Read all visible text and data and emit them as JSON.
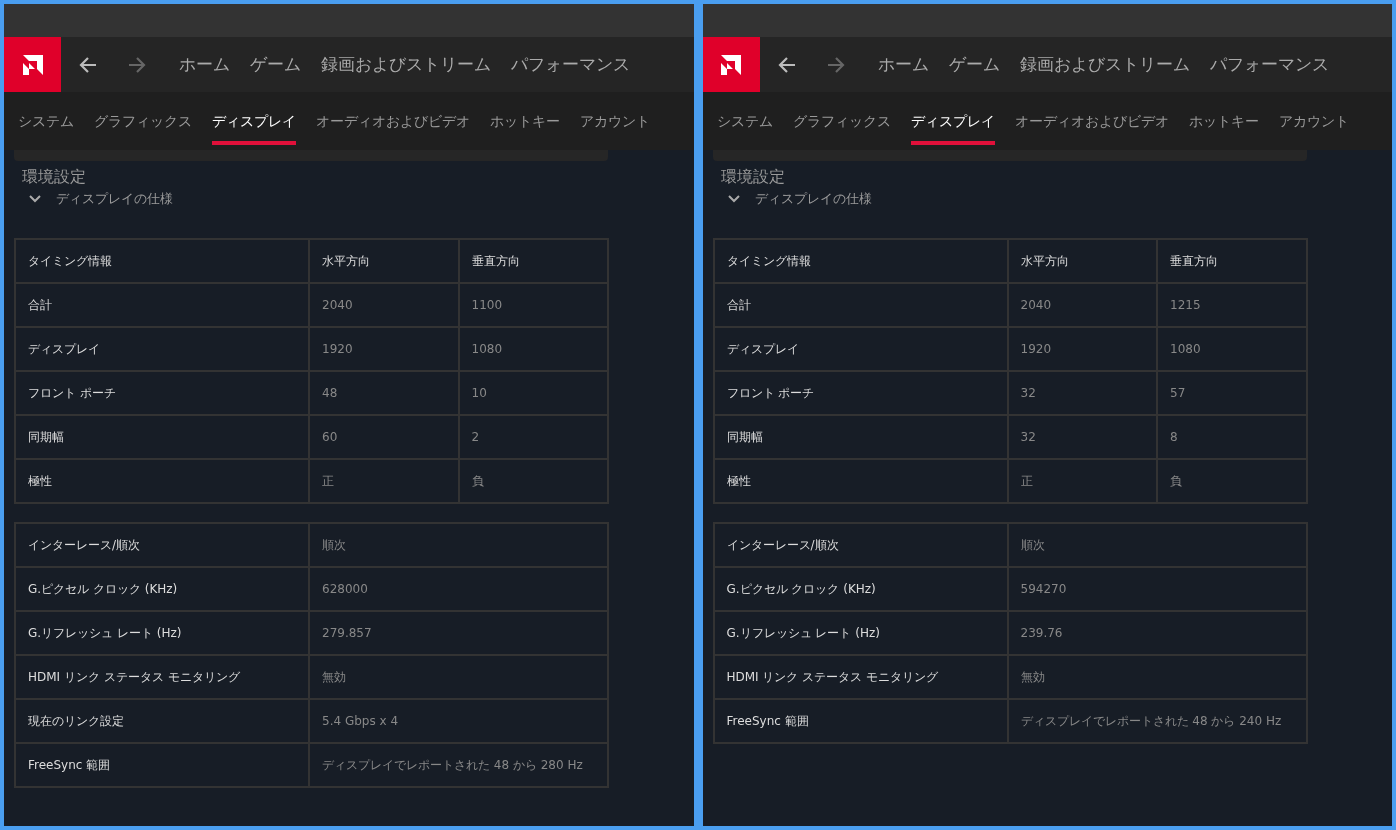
{
  "panels": [
    {
      "nav": [
        {
          "label": "ホーム"
        },
        {
          "label": "ゲーム"
        },
        {
          "label": "録画およびストリーム"
        },
        {
          "label": "パフォーマンス"
        }
      ],
      "tabs": [
        {
          "label": "システム",
          "selected": false
        },
        {
          "label": "グラフィックス",
          "selected": false
        },
        {
          "label": "ディスプレイ",
          "selected": true
        },
        {
          "label": "オーディオおよびビデオ",
          "selected": false
        },
        {
          "label": "ホットキー",
          "selected": false
        },
        {
          "label": "アカウント",
          "selected": false
        }
      ],
      "section_title": "環境設定",
      "subsection": {
        "label": "ディスプレイの仕様",
        "expanded": true
      },
      "timing_table": {
        "columns": [
          "タイミング情報",
          "水平方向",
          "垂直方向"
        ],
        "rows": [
          [
            "合計",
            "2040",
            "1100"
          ],
          [
            "ディスプレイ",
            "1920",
            "1080"
          ],
          [
            "フロント ポーチ",
            "48",
            "10"
          ],
          [
            "同期幅",
            "60",
            "2"
          ],
          [
            "極性",
            "正",
            "負"
          ]
        ]
      },
      "info_table": {
        "rows": [
          [
            "インターレース/順次",
            "順次"
          ],
          [
            "G.ピクセル クロック (KHz)",
            "628000"
          ],
          [
            "G.リフレッシュ レート (Hz)",
            "279.857"
          ],
          [
            "HDMI リンク ステータス モニタリング",
            "無効"
          ],
          [
            "現在のリンク設定",
            "5.4 Gbps x 4"
          ],
          [
            "FreeSync 範囲",
            "ディスプレイでレポートされた 48 から 280 Hz"
          ]
        ]
      }
    },
    {
      "nav": [
        {
          "label": "ホーム"
        },
        {
          "label": "ゲーム"
        },
        {
          "label": "録画およびストリーム"
        },
        {
          "label": "パフォーマンス"
        }
      ],
      "tabs": [
        {
          "label": "システム",
          "selected": false
        },
        {
          "label": "グラフィックス",
          "selected": false
        },
        {
          "label": "ディスプレイ",
          "selected": true
        },
        {
          "label": "オーディオおよびビデオ",
          "selected": false
        },
        {
          "label": "ホットキー",
          "selected": false
        },
        {
          "label": "アカウント",
          "selected": false
        }
      ],
      "section_title": "環境設定",
      "subsection": {
        "label": "ディスプレイの仕様",
        "expanded": true
      },
      "timing_table": {
        "columns": [
          "タイミング情報",
          "水平方向",
          "垂直方向"
        ],
        "rows": [
          [
            "合計",
            "2040",
            "1215"
          ],
          [
            "ディスプレイ",
            "1920",
            "1080"
          ],
          [
            "フロント ポーチ",
            "32",
            "57"
          ],
          [
            "同期幅",
            "32",
            "8"
          ],
          [
            "極性",
            "正",
            "負"
          ]
        ]
      },
      "info_table": {
        "rows": [
          [
            "インターレース/順次",
            "順次"
          ],
          [
            "G.ピクセル クロック (KHz)",
            "594270"
          ],
          [
            "G.リフレッシュ レート (Hz)",
            "239.76"
          ],
          [
            "HDMI リンク ステータス モニタリング",
            "無効"
          ],
          [
            "FreeSync 範囲",
            "ディスプレイでレポートされた 48 から 240 Hz"
          ]
        ]
      }
    }
  ]
}
